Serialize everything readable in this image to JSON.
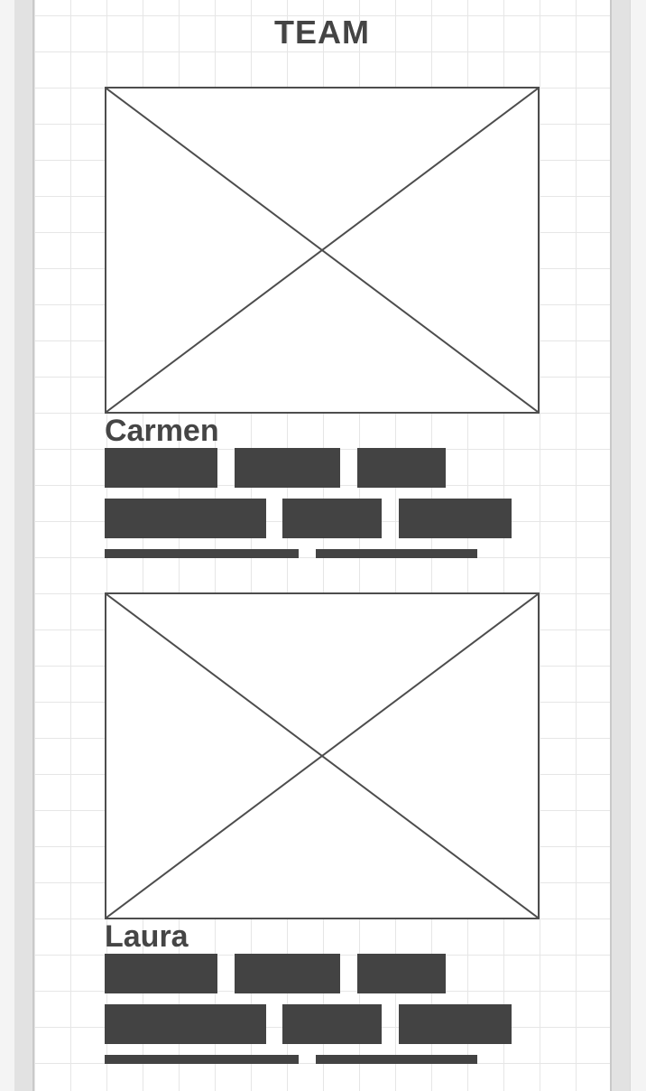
{
  "page": {
    "title": "TEAM"
  },
  "members": [
    {
      "name": "Carmen",
      "photo_icon": "image-placeholder-icon"
    },
    {
      "name": "Laura",
      "photo_icon": "image-placeholder-icon"
    }
  ],
  "colors": {
    "ink": "#434343",
    "grid": "#e6e6e6",
    "frame": "#e2e2e2",
    "background": "#ffffff"
  }
}
